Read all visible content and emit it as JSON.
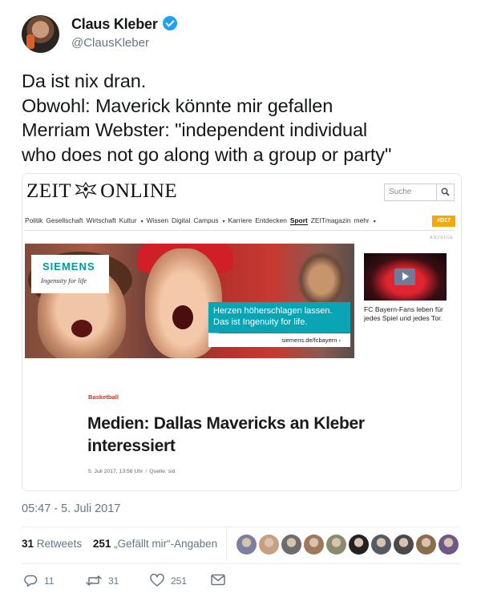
{
  "author": {
    "name": "Claus Kleber",
    "handle": "@ClausKleber",
    "verified": true
  },
  "tweet": {
    "lines": [
      "Da ist nix dran.",
      "Obwohl: Maverick könnte mir gefallen",
      "Merriam Webster: \"independent individual",
      "who does not go along with a group or party\""
    ],
    "timestamp": "05:47 - 5. Juli 2017"
  },
  "card": {
    "logo_left": "ZEIT",
    "logo_right": "ONLINE",
    "search_placeholder": "Suche",
    "nav": [
      {
        "label": "Politik",
        "dropdown": false,
        "active": false
      },
      {
        "label": "Gesellschaft",
        "dropdown": false,
        "active": false
      },
      {
        "label": "Wirtschaft",
        "dropdown": false,
        "active": false
      },
      {
        "label": "Kultur",
        "dropdown": true,
        "active": false
      },
      {
        "label": "Wissen",
        "dropdown": false,
        "active": false
      },
      {
        "label": "Digital",
        "dropdown": false,
        "active": false
      },
      {
        "label": "Campus",
        "dropdown": true,
        "active": false
      },
      {
        "label": "Karriere",
        "dropdown": false,
        "active": false
      },
      {
        "label": "Entdecken",
        "dropdown": false,
        "active": false
      },
      {
        "label": "Sport",
        "dropdown": false,
        "active": true
      },
      {
        "label": "ZEITmagazin",
        "dropdown": false,
        "active": false
      },
      {
        "label": "mehr",
        "dropdown": true,
        "active": false
      }
    ],
    "badge": "#D17",
    "anzeige": "ANZEIGE",
    "ad": {
      "brand": "SIEMENS",
      "tagline": "Ingenuity for life",
      "headline_1": "Herzen höherschlagen lassen.",
      "headline_2": "Das ist Ingenuity for life.",
      "link": "siemens.de/fcbayern ›"
    },
    "video_caption": "FC Bayern-Fans leben für jedes Spiel und jedes Tor.",
    "kicker": "Basketball",
    "article_title": "Medien: Dallas Mavericks an Kleber interessiert",
    "date": "5. Juli 2017, 13:56 Uhr",
    "source": "Quelle: sid"
  },
  "stats": {
    "retweets_count": "31",
    "retweets_label": "Retweets",
    "likes_count": "251",
    "likes_label": "„Gefällt mir“-Angaben"
  },
  "actions": {
    "replies": "11",
    "retweets": "31",
    "likes": "251"
  },
  "colors": {
    "accent": "#1da1f2",
    "muted": "#657786",
    "siemens": "#009999",
    "kicker": "#c0392b",
    "badge": "#f5a800"
  },
  "likers": [
    "#7b7fa0",
    "#c9a07e",
    "#6d6d6d",
    "#a0795a",
    "#8b8b72",
    "#222222",
    "#555a66",
    "#4a4a4a",
    "#8a6d4a",
    "#6e5a88"
  ]
}
